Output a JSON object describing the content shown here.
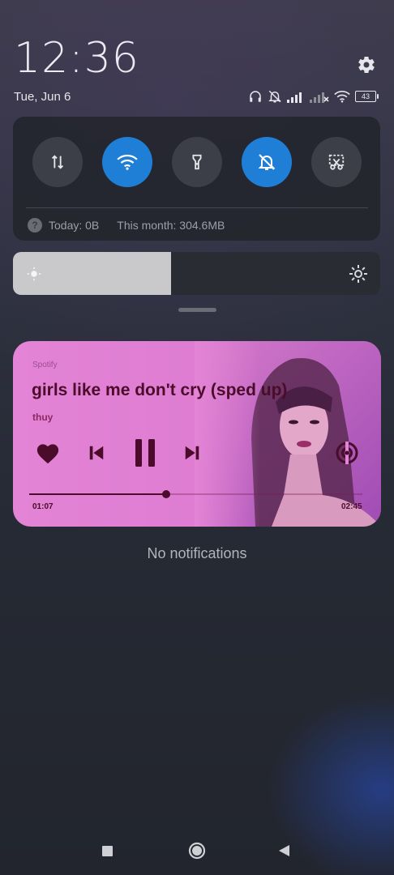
{
  "status": {
    "time": "12:36",
    "date": "Tue, Jun 6",
    "battery": "43"
  },
  "quick_settings": {
    "tiles": [
      {
        "name": "mobile-data",
        "icon": "data-arrows-icon",
        "active": false
      },
      {
        "name": "wifi",
        "icon": "wifi-icon",
        "active": true
      },
      {
        "name": "flashlight",
        "icon": "flashlight-icon",
        "active": false
      },
      {
        "name": "mute",
        "icon": "bell-off-icon",
        "active": true
      },
      {
        "name": "screenshot",
        "icon": "scissors-icon",
        "active": false
      }
    ],
    "usage_today": "Today: 0B",
    "usage_month": "This month: 304.6MB"
  },
  "brightness": {
    "level": 0.43
  },
  "media": {
    "app": "Spotify",
    "title": "girls like me don't cry (sped up)",
    "artist": "thuy",
    "current_time": "01:07",
    "total_time": "02:45",
    "progress": 0.41
  },
  "notifications": {
    "empty_text": "No notifications"
  },
  "colors": {
    "accent": "#1f7fd6",
    "media_bg": "#e484d6",
    "media_text": "#4a0c2a"
  }
}
